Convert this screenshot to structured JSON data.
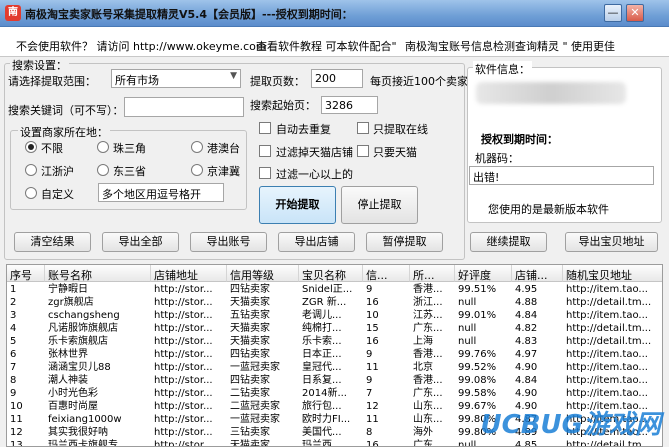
{
  "window": {
    "title": "南极淘宝卖家账号采集提取精灵V5.4【会员版】---授权到期时间：",
    "min_glyph": "—",
    "close_glyph": "✕"
  },
  "banner": {
    "text1": "不会使用软件？ 请访问 http://www.okeyme.com",
    "text2": "查看软件教程 可本软件配合\"",
    "text3": "南极淘宝账号信息检测查询精灵 \" 使用更佳"
  },
  "search": {
    "group_title": "搜索设置：",
    "range_label": "请选择提取范围：",
    "range_value": "所有市场",
    "pages_label": "提取页数：",
    "pages_value": "200",
    "pages_hint": "每页接近100个卖家",
    "keyword_label": "搜索关键词（可不写）：",
    "keyword_value": "",
    "start_page_label": "搜索起始页：",
    "start_page_value": "3286"
  },
  "location": {
    "group_title": "设置商家所在地：",
    "options": [
      "不限",
      "珠三角",
      "港澳台",
      "江浙沪",
      "东三省",
      "京津冀",
      "自定义"
    ],
    "selected": "不限",
    "custom_value": "多个地区用逗号格开"
  },
  "options": {
    "auto_dedupe": "自动去重复",
    "only_online": "只提取在线",
    "filter_tmall": "过滤掉天猫店铺",
    "only_tmall": "只要天猫",
    "filter_one_heart": "过滤一心以上的"
  },
  "actions": {
    "start": "开始提取",
    "stop": "停止提取"
  },
  "software": {
    "group_title": "软件信息：",
    "expire_label": "授权到期时间：",
    "machine_label": "机器码：",
    "machine_value": "出错!",
    "version_note": "您使用的是最新版本软件"
  },
  "toolbar": {
    "clear": "清空结果",
    "export_all": "导出全部",
    "export_account": "导出账号",
    "export_shop": "导出店铺",
    "pause": "暂停提取",
    "resume": "继续提取",
    "export_url": "导出宝贝地址"
  },
  "table": {
    "columns": [
      "序号",
      "账号名称",
      "店铺地址",
      "信用等级",
      "宝贝名称",
      "信...",
      "所...",
      "好评度",
      "店铺...",
      "随机宝贝地址"
    ],
    "rows": [
      [
        "1",
        "宁静暇日",
        "http://stor...",
        "四钻卖家",
        "Snidel正...",
        "9",
        "香港...",
        "99.51%",
        "4.95",
        "http://item.tao..."
      ],
      [
        "2",
        "zgr旗舰店",
        "http://stor...",
        "天猫卖家",
        "ZGR 新...",
        "16",
        "浙江...",
        "null",
        "4.88",
        "http://detail.tm..."
      ],
      [
        "3",
        "cschangsheng",
        "http://stor...",
        "五钻卖家",
        "老调儿...",
        "10",
        "江苏...",
        "99.01%",
        "4.84",
        "http://item.tao..."
      ],
      [
        "4",
        "凡诺服饰旗舰店",
        "http://stor...",
        "天猫卖家",
        "纯棉打...",
        "15",
        "广东...",
        "null",
        "4.82",
        "http://detail.tm..."
      ],
      [
        "5",
        "乐卡索旗舰店",
        "http://stor...",
        "天猫卖家",
        "乐卡索...",
        "16",
        "上海",
        "null",
        "4.83",
        "http://detail.tm..."
      ],
      [
        "6",
        "张林世界",
        "http://stor...",
        "四钻卖家",
        "日本正...",
        "9",
        "香港...",
        "99.76%",
        "4.97",
        "http://item.tao..."
      ],
      [
        "7",
        "涵涵宝贝儿88",
        "http://stor...",
        "一蓝冠卖家",
        "皇冠代...",
        "11",
        "北京",
        "99.52%",
        "4.90",
        "http://item.tao..."
      ],
      [
        "8",
        "潮人神装",
        "http://stor...",
        "四钻卖家",
        "日系复...",
        "9",
        "香港...",
        "99.08%",
        "4.84",
        "http://item.tao..."
      ],
      [
        "9",
        "小时光色彩",
        "http://stor...",
        "二钻卖家",
        "2014新...",
        "7",
        "广东...",
        "99.58%",
        "4.90",
        "http://item.tao..."
      ],
      [
        "10",
        "百惠时尚屋",
        "http://stor...",
        "二蓝冠卖家",
        "旅行包...",
        "12",
        "山东...",
        "99.67%",
        "4.90",
        "http://item.tao..."
      ],
      [
        "11",
        "feixiang1000w",
        "http://stor...",
        "一蓝冠卖家",
        "欧时力FI...",
        "11",
        "山东...",
        "99.80%",
        "4.87",
        "http://item.tao..."
      ],
      [
        "12",
        "其实我很好呐",
        "http://stor...",
        "三钻卖家",
        "美国代...",
        "8",
        "海外",
        "99.80%",
        "4.89",
        "http://item.tao..."
      ],
      [
        "13",
        "玛兰西卡旗舰专...",
        "http://stor...",
        "天猫卖家",
        "玛兰西...",
        "16",
        "广东...",
        "null",
        "4.85",
        "http://detail.tm..."
      ]
    ]
  },
  "watermark": {
    "main": "UCBUG游戏网",
    "sub": ".com"
  }
}
